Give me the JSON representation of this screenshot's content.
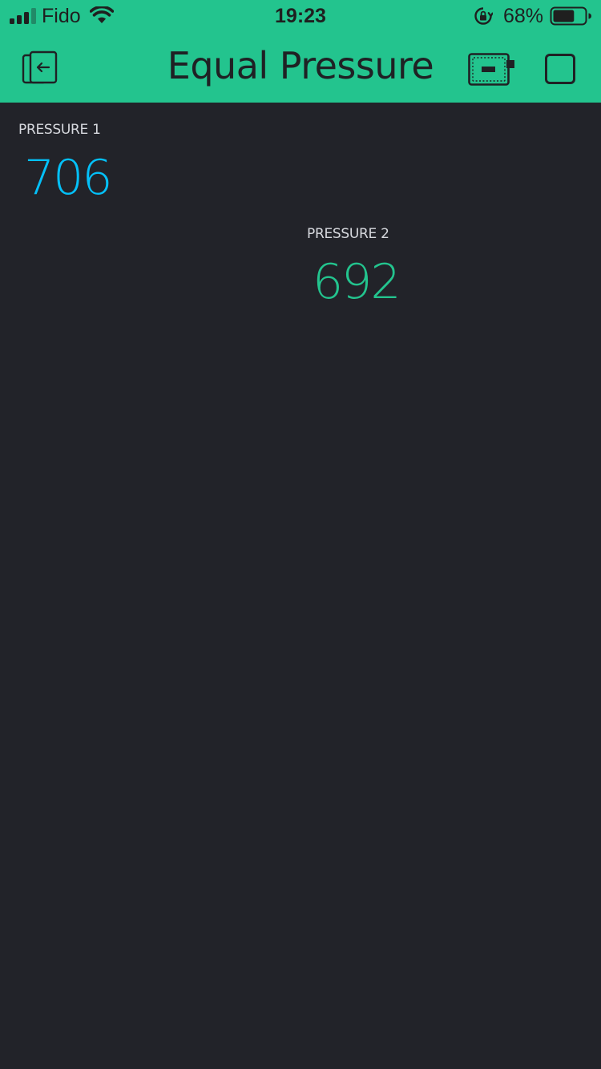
{
  "status_bar": {
    "carrier": "Fido",
    "time": "19:23",
    "battery_percent": "68%",
    "battery_level": 0.68,
    "signal_bars": 3
  },
  "header": {
    "title": "Equal Pressure",
    "background_color": "#23c48e"
  },
  "widgets": [
    {
      "label": "PRESSURE 1",
      "value": "706",
      "color": "#04c0f8"
    },
    {
      "label": "PRESSURE 2",
      "value": "692",
      "color": "#23c48e"
    }
  ],
  "icons": {
    "back": "exit-project-icon",
    "device": "device-board-icon",
    "stop": "stop-icon"
  }
}
